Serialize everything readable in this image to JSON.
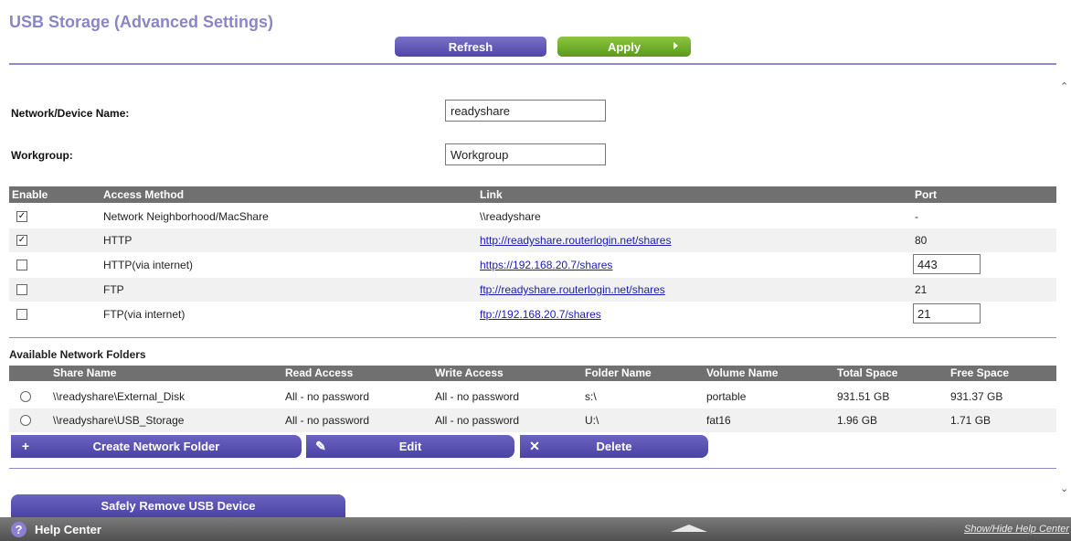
{
  "page": {
    "title": "USB Storage (Advanced Settings)"
  },
  "toolbar": {
    "refresh_label": "Refresh",
    "apply_label": "Apply"
  },
  "settings": {
    "device_name_label": "Network/Device Name:",
    "device_name_value": "readyshare",
    "workgroup_label": "Workgroup:",
    "workgroup_value": "Workgroup"
  },
  "access_table": {
    "headers": {
      "enable": "Enable",
      "method": "Access Method",
      "link": "Link",
      "port": "Port"
    },
    "rows": [
      {
        "checked": true,
        "method": "Network Neighborhood/MacShare",
        "link": "\\\\readyshare",
        "link_is_url": false,
        "port": "-",
        "port_editable": false
      },
      {
        "checked": true,
        "method": "HTTP",
        "link": "http://readyshare.routerlogin.net/shares",
        "link_is_url": true,
        "port": "80",
        "port_editable": false
      },
      {
        "checked": false,
        "method": "HTTP(via internet)",
        "link": "https://192.168.20.7/shares",
        "link_is_url": true,
        "port": "443",
        "port_editable": true
      },
      {
        "checked": false,
        "method": "FTP",
        "link": "ftp://readyshare.routerlogin.net/shares",
        "link_is_url": true,
        "port": "21",
        "port_editable": false
      },
      {
        "checked": false,
        "method": "FTP(via internet)",
        "link": "ftp://192.168.20.7/shares",
        "link_is_url": true,
        "port": "21",
        "port_editable": true
      }
    ]
  },
  "folders": {
    "section_title": "Available Network Folders",
    "headers": {
      "share_name": "Share Name",
      "read_access": "Read Access",
      "write_access": "Write Access",
      "folder_name": "Folder Name",
      "volume_name": "Volume Name",
      "total_space": "Total Space",
      "free_space": "Free Space"
    },
    "rows": [
      {
        "share_name": "\\\\readyshare\\External_Disk",
        "read_access": "All - no password",
        "write_access": "All - no password",
        "folder_name": "s:\\",
        "volume_name": "portable",
        "total_space": "931.51 GB",
        "free_space": "931.37 GB"
      },
      {
        "share_name": "\\\\readyshare\\USB_Storage",
        "read_access": "All - no password",
        "write_access": "All - no password",
        "folder_name": "U:\\",
        "volume_name": "fat16",
        "total_space": "1.96 GB",
        "free_space": "1.71 GB"
      }
    ],
    "create_label": "Create Network Folder",
    "edit_label": "Edit",
    "delete_label": "Delete"
  },
  "remove_usb_label": "Safely Remove USB Device",
  "footer": {
    "help_label": "Help Center",
    "show_hide_label": "Show/Hide Help Center"
  },
  "colors": {
    "title": "#8a86c6",
    "accent_purple": "#5a51b3",
    "apply_green": "#7ab33a",
    "header_gray": "#707070"
  }
}
